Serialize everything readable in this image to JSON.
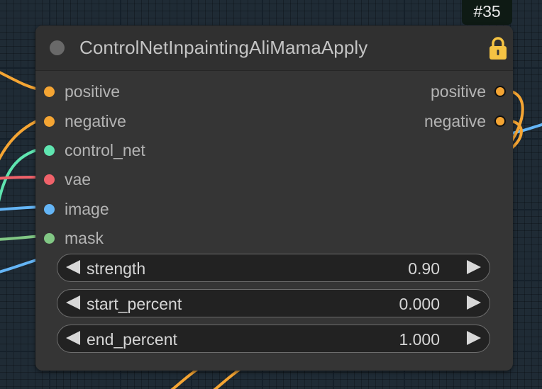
{
  "node": {
    "id_badge": "#35",
    "title": "ControlNetInpaintingAliMamaApply",
    "icons": {
      "status": "circle-dot-icon",
      "lock": "lock-icon"
    },
    "inputs": [
      {
        "label": "positive",
        "color": "#f5a533"
      },
      {
        "label": "negative",
        "color": "#f5a533"
      },
      {
        "label": "control_net",
        "color": "#5fe5b0"
      },
      {
        "label": "vae",
        "color": "#f0626a"
      },
      {
        "label": "image",
        "color": "#64b5f6"
      },
      {
        "label": "mask",
        "color": "#81c784"
      }
    ],
    "outputs": [
      {
        "label": "positive",
        "color": "#f5a533"
      },
      {
        "label": "negative",
        "color": "#f5a533"
      }
    ],
    "widgets": [
      {
        "label": "strength",
        "value": "0.90"
      },
      {
        "label": "start_percent",
        "value": "0.000"
      },
      {
        "label": "end_percent",
        "value": "1.000"
      }
    ]
  },
  "theme": {
    "canvas_bg": "#1f2b35",
    "node_bg": "#353535",
    "title_bg": "#303030",
    "lock_color": "#f5c343"
  }
}
